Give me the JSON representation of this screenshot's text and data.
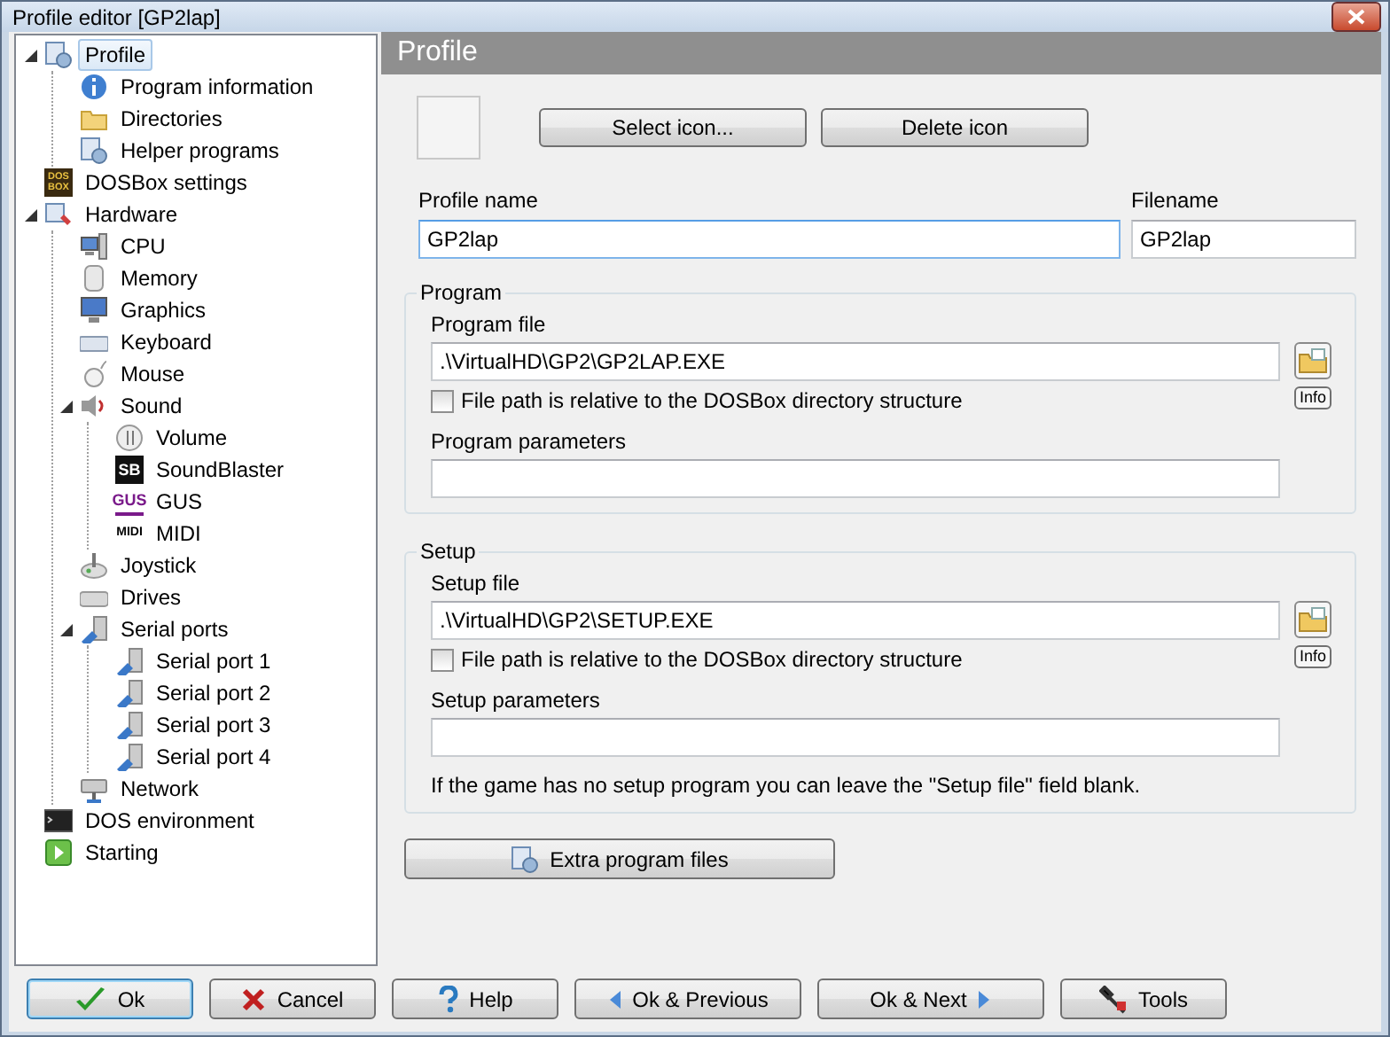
{
  "window": {
    "title": "Profile editor [GP2lap]"
  },
  "tree": [
    {
      "label": "Profile",
      "selected": true,
      "expanded": true,
      "children": [
        {
          "label": "Program information",
          "selected": false
        },
        {
          "label": "Directories",
          "selected": false
        },
        {
          "label": "Helper programs",
          "selected": false
        }
      ]
    },
    {
      "label": "DOSBox settings",
      "selected": false,
      "badge": "DOS BOX"
    },
    {
      "label": "Hardware",
      "selected": false,
      "expanded": true,
      "children": [
        {
          "label": "CPU",
          "selected": false
        },
        {
          "label": "Memory",
          "selected": false
        },
        {
          "label": "Graphics",
          "selected": false
        },
        {
          "label": "Keyboard",
          "selected": false
        },
        {
          "label": "Mouse",
          "selected": false
        },
        {
          "label": "Sound",
          "selected": false,
          "expanded": true,
          "children": [
            {
              "label": "Volume",
              "selected": false
            },
            {
              "label": "SoundBlaster",
              "selected": false,
              "badge": "SB"
            },
            {
              "label": "GUS",
              "selected": false,
              "badge": "GUS"
            },
            {
              "label": "MIDI",
              "selected": false,
              "badge": "MIDI"
            }
          ]
        },
        {
          "label": "Joystick",
          "selected": false
        },
        {
          "label": "Drives",
          "selected": false
        },
        {
          "label": "Serial ports",
          "selected": false,
          "expanded": true,
          "children": [
            {
              "label": "Serial port 1",
              "selected": false
            },
            {
              "label": "Serial port 2",
              "selected": false
            },
            {
              "label": "Serial port 3",
              "selected": false
            },
            {
              "label": "Serial port 4",
              "selected": false
            }
          ]
        },
        {
          "label": "Network",
          "selected": false
        }
      ]
    },
    {
      "label": "DOS environment",
      "selected": false
    },
    {
      "label": "Starting",
      "selected": false
    }
  ],
  "panel": {
    "title": "Profile",
    "icon_buttons": [
      "Select icon...",
      "Delete icon"
    ],
    "profile_name": {
      "label": "Profile name",
      "value": "GP2lap"
    },
    "filename": {
      "label": "Filename",
      "value": "GP2lap"
    },
    "groups": [
      {
        "title": "Program",
        "file_label": "Program file",
        "file_value": ".\\VirtualHD\\GP2\\GP2LAP.EXE",
        "relative_label": "File path is relative to the DOSBox directory structure",
        "relative_checked": false,
        "info": "Info",
        "params_label": "Program parameters"
      },
      {
        "title": "Setup",
        "file_label": "Setup file",
        "file_value": ".\\VirtualHD\\GP2\\SETUP.EXE",
        "relative_label": "File path is relative to the DOSBox directory structure",
        "relative_checked": false,
        "info": "Info",
        "params_label": "Setup parameters",
        "note": "If the game has no setup program you can leave the \"Setup file\" field blank."
      }
    ],
    "extra_button": "Extra program files"
  },
  "buttons": [
    {
      "label": "Ok",
      "kind": "ok",
      "default": true
    },
    {
      "label": "Cancel",
      "kind": "cancel",
      "default": false
    },
    {
      "label": "Help",
      "kind": "help",
      "default": false
    },
    {
      "label": "Ok & Previous",
      "kind": "prev",
      "default": false
    },
    {
      "label": "Ok & Next",
      "kind": "next",
      "default": false
    },
    {
      "label": "Tools",
      "kind": "tools",
      "default": false
    }
  ]
}
